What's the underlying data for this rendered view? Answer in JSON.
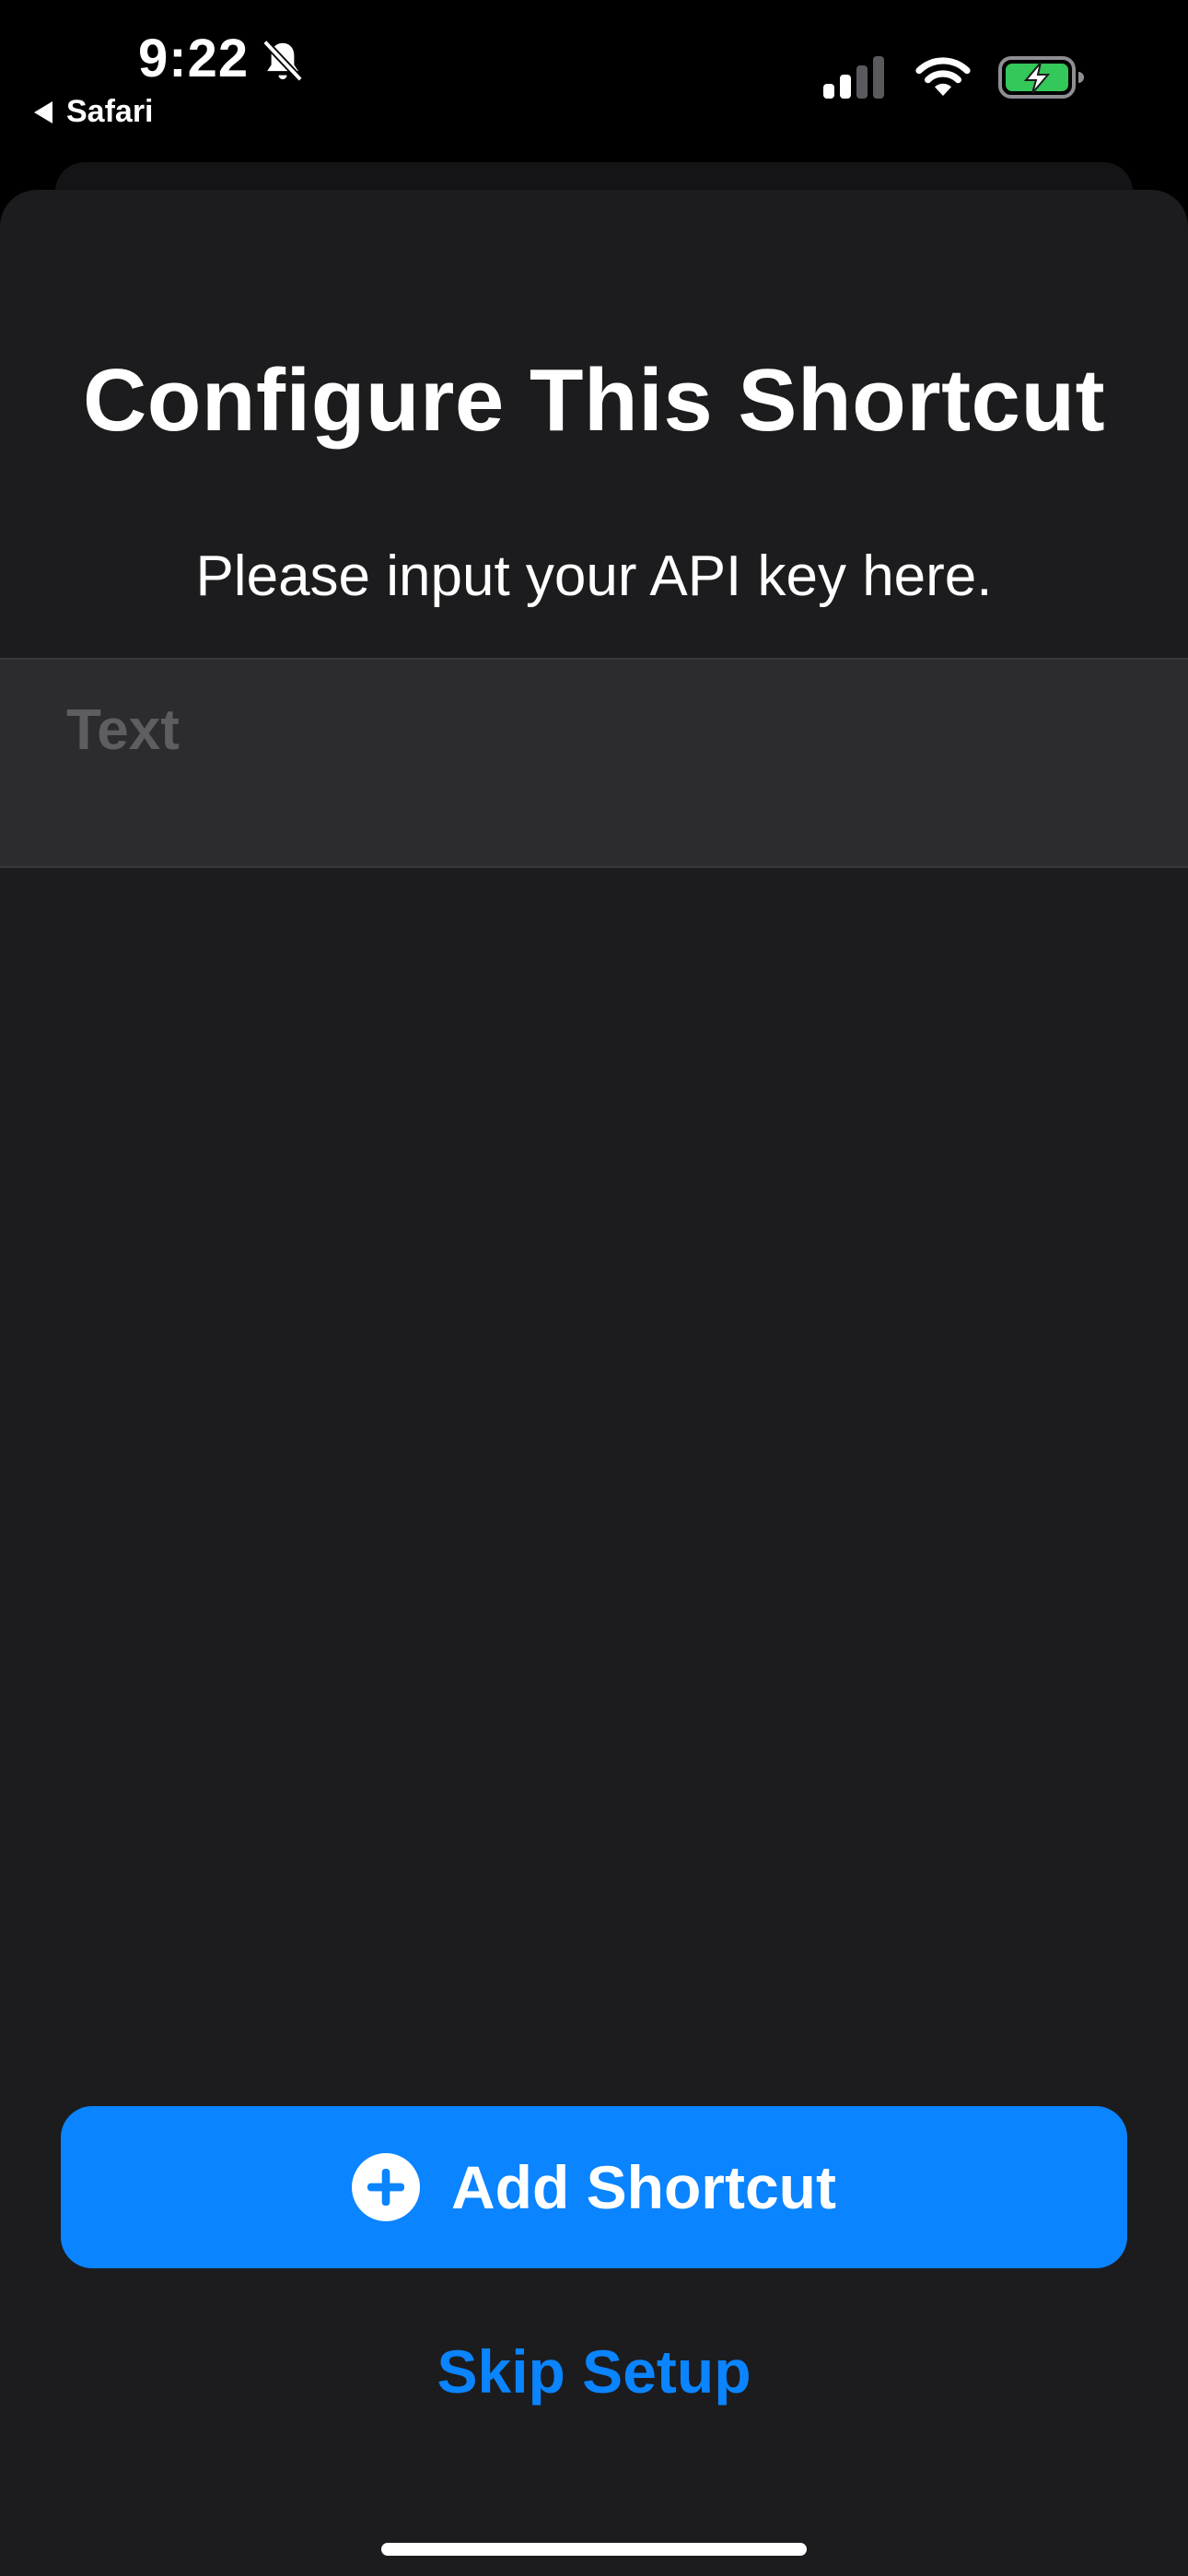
{
  "status_bar": {
    "time": "9:22",
    "back_app": "Safari",
    "icons": [
      "bell-slash-icon",
      "cellular-signal-icon",
      "wifi-icon",
      "battery-charging-icon"
    ]
  },
  "sheet": {
    "title": "Configure This Shortcut",
    "subtitle": "Please input your API key here.",
    "field": {
      "value": "",
      "placeholder": "Text"
    },
    "primary_button": {
      "label": "Add Shortcut",
      "icon": "plus-circle-icon"
    },
    "secondary_button": {
      "label": "Skip Setup"
    }
  },
  "colors": {
    "background": "#000000",
    "sheet": "#1c1c1e",
    "field": "#2c2c2e",
    "accent": "#0a84ff",
    "battery": "#34c759"
  }
}
